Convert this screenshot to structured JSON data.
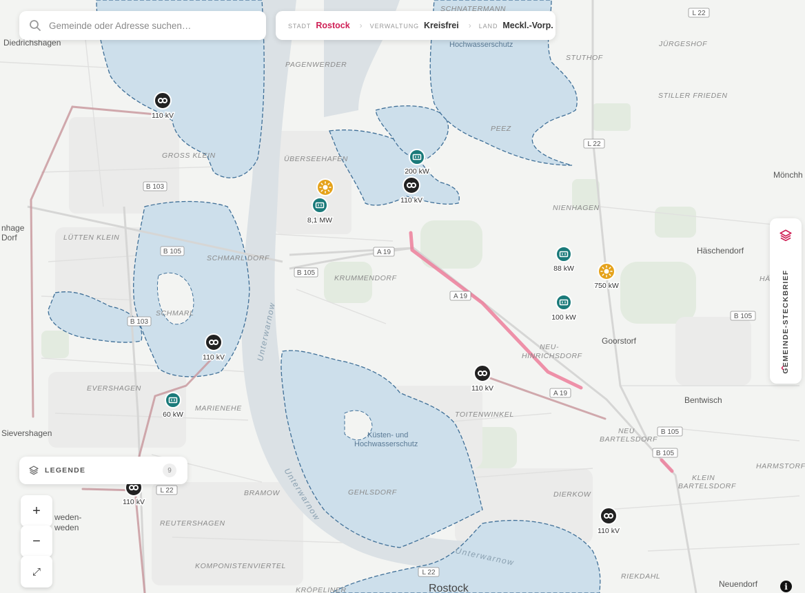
{
  "search": {
    "placeholder": "Gemeinde oder Adresse suchen…"
  },
  "breadcrumb": {
    "stadt_key": "STADT",
    "stadt_value": "Rostock",
    "verwaltung_key": "VERWALTUNG",
    "verwaltung_value": "Kreisfrei",
    "land_key": "LAND",
    "land_value": "Meckl.-Vorp.",
    "separator": "›"
  },
  "legend": {
    "label": "LEGENDE",
    "count": "9"
  },
  "zoom": {
    "in": "+",
    "out": "−",
    "fullscreen": "⤢"
  },
  "side_panel": {
    "label": "GEMEINDE-STECKBRIEF",
    "chevron": "‹"
  },
  "info_label": "i",
  "colors": {
    "accent": "#cf1f55",
    "flood_area": "#cddfeb",
    "flood_border": "#3f6f97",
    "substation": "#222222",
    "storage": "#1a7a7a",
    "solar": "#e5a21a",
    "powerline": "#c99aa0",
    "powerline_highlight": "#ec7e9b"
  },
  "map": {
    "places": {
      "diedrichshagen": "Diedrichshagen",
      "schnatermann": "SCHNATERMANN",
      "pagenwerder": "PAGENWERDER",
      "juergeshof": "JÜRGESHOF",
      "stuthof": "STUTHOF",
      "stiller_frieden": "STILLER FRIEDEN",
      "gross_klein": "GROSS KLEIN",
      "ueberseehafen": "ÜBERSEEHAFEN",
      "peez": "PEEZ",
      "nienhagen": "NIENHAGEN",
      "moenchhagen": "Mönchh",
      "lichtenhagen": "nhage",
      "dorf": "Dorf",
      "luetten_klein": "LÜTTEN KLEIN",
      "schmarl_dorf": "SCHMARL DORF",
      "krummendorf": "KRUMMENDORF",
      "haeschendorf": "Häschendorf",
      "hae": "HÄ",
      "schmarl": "SCHMARL",
      "goorstorf": "Goorstorf",
      "neu_hinrichsdorf_1": "NEU-",
      "neu_hinrichsdorf_2": "HINRICHSDORF",
      "evershagen": "EVERSHAGEN",
      "marienehe": "MARIENEHE",
      "toitenwinkel": "TOITENWINKEL",
      "bentwisch": "Bentwisch",
      "sievershagen": "Sievershagen",
      "neu_bartelsdorf_1": "NEU",
      "neu_bartelsdorf_2": "BARTELSDORF",
      "harmstorf": "HARMSTORF",
      "klein_bartelsdorf_1": "KLEIN",
      "klein_bartelsdorf_2": "BARTELSDORF",
      "bramow": "BRAMOW",
      "gehlsdorf": "GEHLSDORF",
      "dierkow": "DIERKOW",
      "schwaan_1": "weden-",
      "schwaan_2": "weden",
      "reutershagen": "REUTERSHAGEN",
      "komponistenviertel": "KOMPONISTENVIERTEL",
      "riekdahl": "RIEKDAHL",
      "neuendorf": "Neuendorf",
      "koepelinerk": "KRÖPELINER",
      "rostock": "Rostock"
    },
    "water_labels": {
      "hochwasserschutz_top": "Hochwasserschutz",
      "kuesten_1": "Küsten- und",
      "kuesten_2": "Hochwasserschutz"
    },
    "rivers": {
      "unterwarnow_1": "Unterwarnow",
      "unterwarnow_2": "Unterwarnow",
      "unterwarnow_3": "Unterwarnow"
    },
    "roads": {
      "l22_a": "L 22",
      "l22_b": "L 22",
      "l22_c": "L 22",
      "l22_d": "L 22",
      "b103_a": "B 103",
      "b103_b": "B 103",
      "b105_a": "B 105",
      "b105_b": "B 105",
      "b105_c": "B 105",
      "b105_d": "B 105",
      "b105_e": "B 105",
      "a19_a": "A 19",
      "a19_b": "A 19",
      "a19_c": "A 19"
    },
    "markers": {
      "sub_1": "110 kV",
      "sub_2": "110 kV",
      "sub_3": "110 kV",
      "sub_4": "110 kV",
      "sub_5": "110 kV",
      "sub_6": "110 kV",
      "storage_1": "200 kW",
      "storage_2": "8,1 MW",
      "storage_3": "88 kW",
      "storage_4": "100 kW",
      "storage_5": "60 kW",
      "solar_1": "750 kW"
    }
  }
}
